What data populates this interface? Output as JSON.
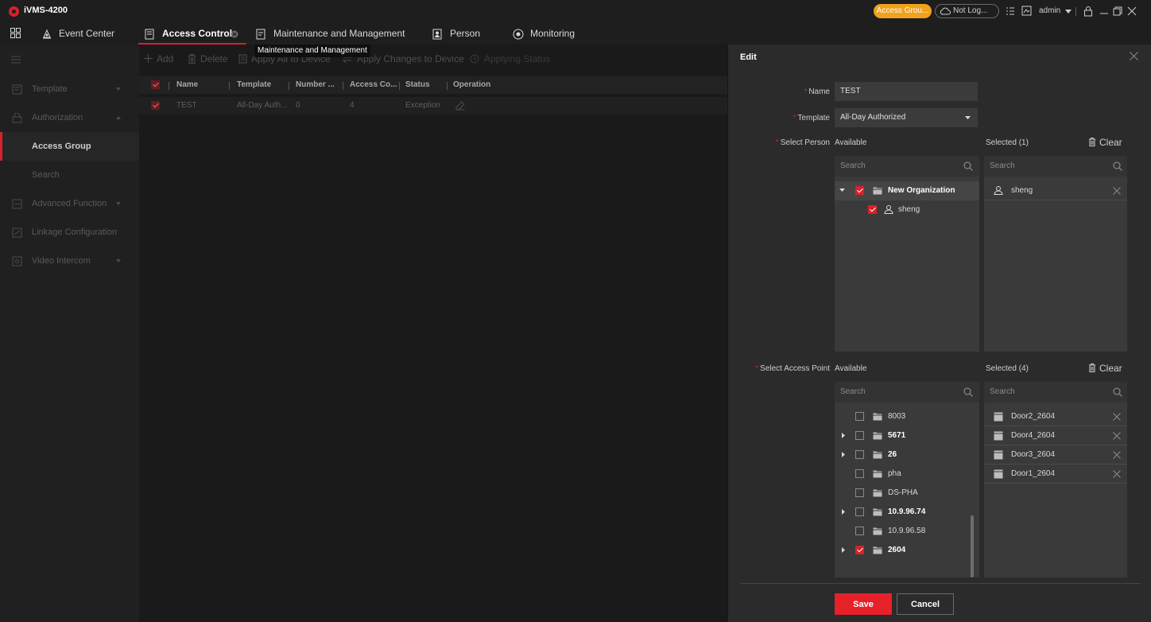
{
  "window": {
    "title": "iVMS-4200",
    "badge": "Access Grou...",
    "cloud_status": "Not Log...",
    "user": "admin"
  },
  "nav": {
    "tabs": [
      {
        "label": "Event Center",
        "icon": "event-center-icon"
      },
      {
        "label": "Access Control",
        "icon": "access-control-icon",
        "active": true
      },
      {
        "label": "Maintenance and Management",
        "icon": "maintenance-icon"
      },
      {
        "label": "Person",
        "icon": "person-icon"
      },
      {
        "label": "Monitoring",
        "icon": "monitoring-icon"
      }
    ],
    "tooltip": "Maintenance and Management"
  },
  "sidebar": {
    "items": [
      {
        "label": "Template",
        "icon": "template-icon",
        "expandable": true
      },
      {
        "label": "Authorization",
        "icon": "authorization-icon",
        "expanded": true
      },
      {
        "label": "Access Group",
        "active": true
      },
      {
        "label": "Search"
      },
      {
        "label": "Advanced Function",
        "icon": "advanced-function-icon",
        "expandable": true
      },
      {
        "label": "Linkage Configuration",
        "icon": "linkage-icon"
      },
      {
        "label": "Video Intercom",
        "icon": "video-intercom-icon",
        "expandable": true
      }
    ]
  },
  "toolbar": {
    "add": "Add",
    "delete": "Delete",
    "apply_all": "Apply All to Device",
    "apply_changes": "Apply Changes to Device",
    "applying_status": "Applying Status"
  },
  "grid": {
    "columns": [
      "Name",
      "Template",
      "Number ...",
      "Access Co...",
      "Status",
      "Operation"
    ],
    "rows": [
      {
        "name": "TEST",
        "template": "All-Day Auth...",
        "number": "0",
        "access_count": "4",
        "status": "Exception",
        "checked": true
      }
    ]
  },
  "edit": {
    "title": "Edit",
    "name_label": "Name",
    "name_value": "TEST",
    "template_label": "Template",
    "template_value": "All-Day Authorized",
    "select_person_label": "Select Person",
    "select_access_point_label": "Select Access Point",
    "available_label": "Available",
    "person_selected_label": "Selected (1)",
    "ap_selected_label": "Selected (4)",
    "clear_label": "Clear",
    "search_placeholder": "Search",
    "person_tree": {
      "org": "New Organization",
      "person": "sheng"
    },
    "person_selected": [
      "sheng"
    ],
    "ap_tree": [
      {
        "label": "8003",
        "expandable": false,
        "bold": false,
        "checked": false
      },
      {
        "label": "5671",
        "expandable": true,
        "bold": true,
        "checked": false
      },
      {
        "label": "26",
        "expandable": true,
        "bold": true,
        "checked": false
      },
      {
        "label": "pha",
        "expandable": false,
        "bold": false,
        "checked": false
      },
      {
        "label": "DS-PHA",
        "expandable": false,
        "bold": false,
        "checked": false
      },
      {
        "label": "10.9.96.74",
        "expandable": true,
        "bold": true,
        "checked": false
      },
      {
        "label": "10.9.96.58",
        "expandable": false,
        "bold": false,
        "checked": false
      },
      {
        "label": "2604",
        "expandable": true,
        "bold": true,
        "checked": true
      }
    ],
    "ap_selected": [
      "Door2_2604",
      "Door4_2604",
      "Door3_2604",
      "Door1_2604"
    ],
    "save": "Save",
    "cancel": "Cancel"
  },
  "colors": {
    "accent": "#e62129",
    "badge": "#f0a21d",
    "panel": "#2b2b2b"
  }
}
